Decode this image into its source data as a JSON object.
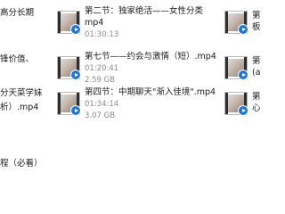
{
  "left_column_fragments": [
    {
      "line": "高分长期"
    },
    {
      "line": "锋价值、"
    },
    {
      "line": "分天菜学妹"
    },
    {
      "line": "析）.mp4"
    },
    {
      "line": "程（必看）"
    }
  ],
  "files": [
    {
      "name_line1": "第二节：独家绝活——女性分类",
      "name_line2": "mp4",
      "duration": "01:30:13",
      "size": ""
    },
    {
      "name_line1": "第七节——约会与激情（短）.mp4",
      "name_line2": "",
      "duration": "01:20:41",
      "size": "2.59 GB"
    },
    {
      "name_line1": "第四节：中期聊天\"渐入佳境\".mp4",
      "name_line2": "",
      "duration": "01:34:14",
      "size": "3.07 GB"
    }
  ],
  "right_column_fragments": [
    {
      "line": "第",
      "line2": "板"
    },
    {
      "line": "第",
      "line2": "(a"
    },
    {
      "line": "第",
      "line2": "心"
    }
  ]
}
